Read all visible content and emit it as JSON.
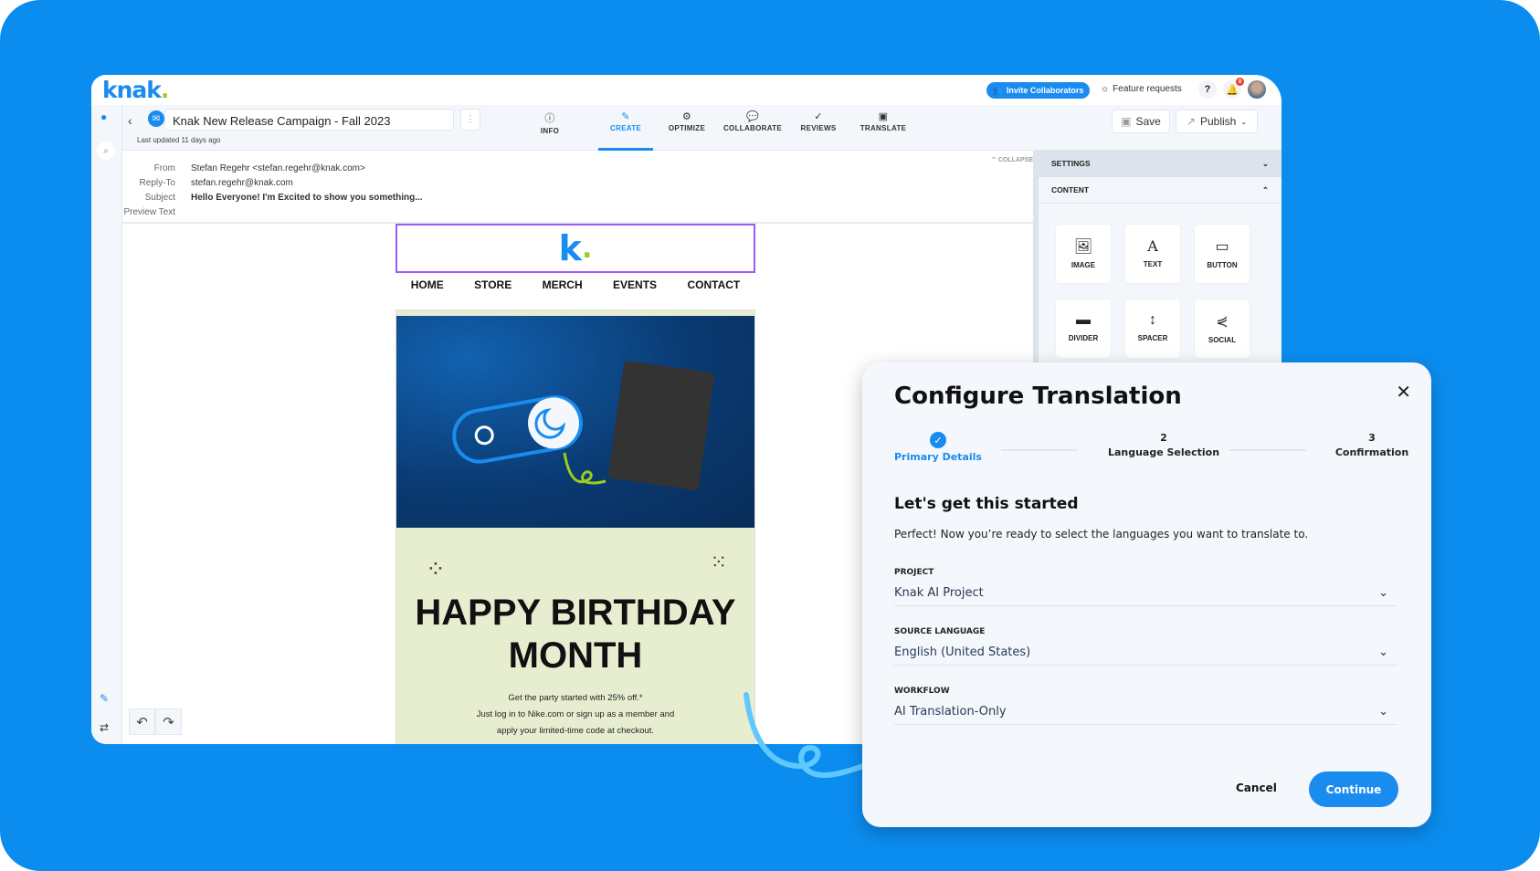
{
  "app": {
    "logo": "knak",
    "invite_label": "Invite Collaborators",
    "feature_requests": "Feature requests",
    "help": "?",
    "notifications_count": "8"
  },
  "campaign": {
    "title": "Knak New Release Campaign - Fall 2023",
    "last_updated": "Last updated 11 days ago"
  },
  "tabs": [
    {
      "label": "INFO",
      "icon": "info-icon"
    },
    {
      "label": "CREATE",
      "icon": "edit-icon",
      "active": true
    },
    {
      "label": "OPTIMIZE",
      "icon": "optimize-icon"
    },
    {
      "label": "COLLABORATE",
      "icon": "chat-icon"
    },
    {
      "label": "REVIEWS",
      "icon": "check-circle-icon"
    },
    {
      "label": "TRANSLATE",
      "icon": "translate-icon"
    }
  ],
  "toolbar": {
    "save": "Save",
    "publish": "Publish"
  },
  "fields": {
    "from_label": "From",
    "from": "Stefan Regehr <stefan.regehr@knak.com>",
    "reply_label": "Reply-To",
    "reply": "stefan.regehr@knak.com",
    "subject_label": "Subject",
    "subject": "Hello Everyone! I'm Excited to show you something...",
    "preview_label": "Preview Text",
    "collapse": "COLLAPSE"
  },
  "email": {
    "nav": [
      "HOME",
      "STORE",
      "MERCH",
      "EVENTS",
      "CONTACT"
    ],
    "headline": "HAPPY BIRTHDAY MONTH",
    "line1": "Get the party started with 25% off.*",
    "line2": "Just log in to Nike.com or sign up as a member and",
    "line3": "apply your limited-time code at checkout."
  },
  "panel": {
    "settings": "SETTINGS",
    "content": "CONTENT",
    "blocks": [
      "IMAGE",
      "TEXT",
      "BUTTON",
      "DIVIDER",
      "SPACER",
      "SOCIAL"
    ]
  },
  "modal": {
    "title": "Configure Translation",
    "steps": [
      {
        "num": "",
        "label": "Primary Details",
        "done": true
      },
      {
        "num": "2",
        "label": "Language Selection"
      },
      {
        "num": "3",
        "label": "Confirmation"
      }
    ],
    "subtitle": "Let's get this started",
    "text": "Perfect! Now you’re ready to select the languages you want to translate to.",
    "project_label": "PROJECT",
    "project": "Knak AI Project",
    "source_label": "SOURCE LANGUAGE",
    "source": "English (United States)",
    "workflow_label": "WORKFLOW",
    "workflow": "AI Translation-Only",
    "cancel": "Cancel",
    "continue": "Continue"
  },
  "colors": {
    "brand": "#1a8cf0",
    "accent": "#9acd1e",
    "background": "#0b8df0"
  }
}
